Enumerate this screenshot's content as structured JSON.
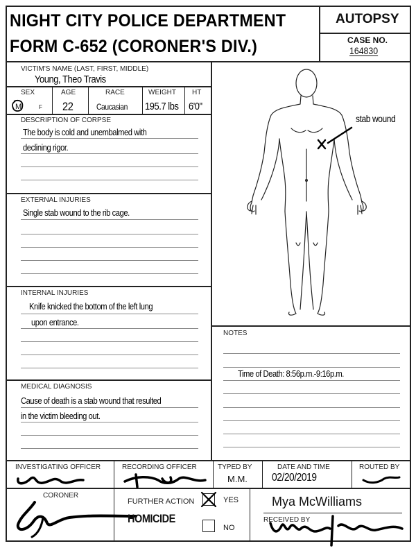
{
  "header": {
    "line1": "NIGHT CITY POLICE DEPARTMENT",
    "line2": "FORM C-652 (CORONER'S DIV.)",
    "form_type": "AUTOPSY",
    "case_no_label": "CASE NO.",
    "case_no": "164830"
  },
  "victim": {
    "name_label": "VICTIM'S NAME (LAST, FIRST, MIDDLE)",
    "name": "Young, Theo Travis",
    "sex_label": "SEX",
    "sex_m": "M",
    "sex_f": "F",
    "age_label": "AGE",
    "age": "22",
    "race_label": "RACE",
    "race": "Caucasian",
    "weight_label": "WEIGHT",
    "weight": "195.7 lbs",
    "ht_label": "HT",
    "ht": "6'0\""
  },
  "description": {
    "label": "DESCRIPTION OF CORPSE",
    "line1": "The body is cold and unembalmed with",
    "line2": "declining rigor."
  },
  "external": {
    "label": "EXTERNAL INJURIES",
    "line1": "Single stab wound to the rib cage."
  },
  "internal": {
    "label": "INTERNAL INJURIES",
    "line1": "Knife knicked the bottom of the  left lung",
    "line2": "upon entrance."
  },
  "diagnosis": {
    "label": "MEDICAL DIAGNOSIS",
    "line1": "Cause of death is a stab wound that resulted",
    "line2": "in the victim bleeding out."
  },
  "body_diagram": {
    "annotation": "stab wound"
  },
  "notes": {
    "label": "NOTES",
    "line1": "Time of Death: 8:56p.m.-9:16p.m."
  },
  "footer": {
    "investigating_label": "INVESTIGATING OFFICER",
    "recording_label": "RECORDING OFFICER",
    "typed_by_label": "TYPED BY",
    "typed_by": "M.M.",
    "date_label": "DATE AND TIME",
    "date": "02/20/2019",
    "routed_by_label": "ROUTED BY",
    "coroner_label": "CORONER",
    "further_action_label": "FURTHER ACTION",
    "further_action": "HOMICIDE",
    "yes_label": "YES",
    "no_label": "NO",
    "typed_name": "Mya McWilliams",
    "received_by_label": "RECEIVED BY"
  }
}
